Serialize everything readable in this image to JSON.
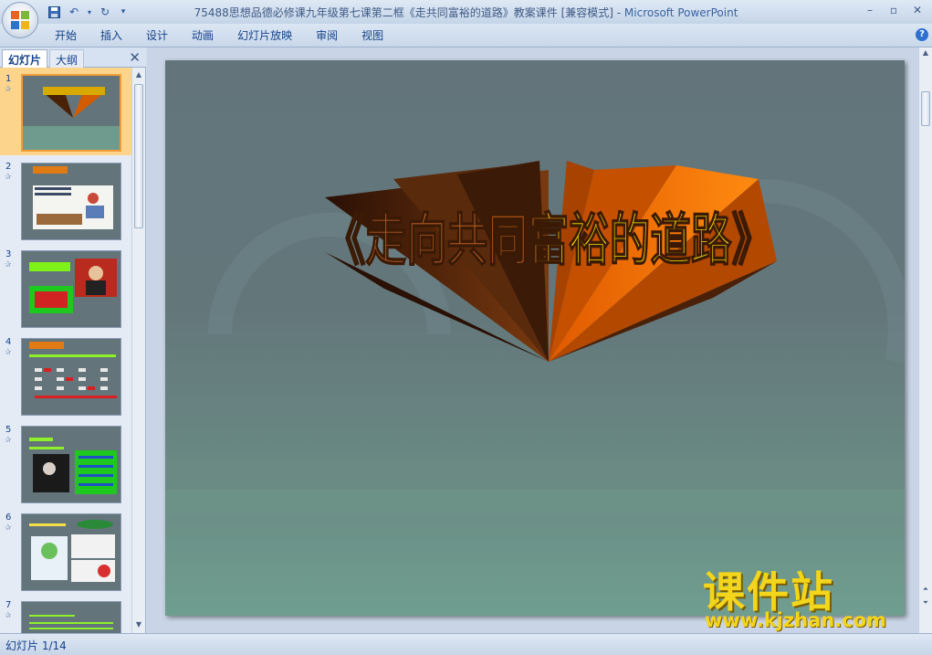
{
  "window": {
    "title": "75488思想品德必修课九年级第七课第二框《走共同富裕的道路》教案课件 [兼容模式]",
    "app_name": "Microsoft PowerPoint",
    "separator": " - "
  },
  "ribbon": {
    "tabs": [
      "开始",
      "插入",
      "设计",
      "动画",
      "幻灯片放映",
      "审阅",
      "视图"
    ]
  },
  "panel": {
    "tab_slides": "幻灯片",
    "tab_outline": "大纲",
    "thumbnails": [
      {
        "num": "1",
        "selected": true
      },
      {
        "num": "2",
        "selected": false
      },
      {
        "num": "3",
        "selected": false
      },
      {
        "num": "4",
        "selected": false
      },
      {
        "num": "5",
        "selected": false
      },
      {
        "num": "6",
        "selected": false
      },
      {
        "num": "7",
        "selected": false
      }
    ]
  },
  "slide": {
    "title": "《走向共同富裕的道路》"
  },
  "watermark": {
    "cn": "课件站",
    "url": "www.kjzhan.com"
  },
  "status": {
    "slide_counter": "幻灯片 1/14"
  },
  "colors": {
    "slide_bg_top": "#63757b",
    "slide_bg_bottom": "#6f9e90",
    "title_yellow": "#ffe600",
    "extrude_dark": "#3b1a08",
    "extrude_orange": "#e06000",
    "watermark": "#f3d51b",
    "selection": "#fcd48b"
  }
}
